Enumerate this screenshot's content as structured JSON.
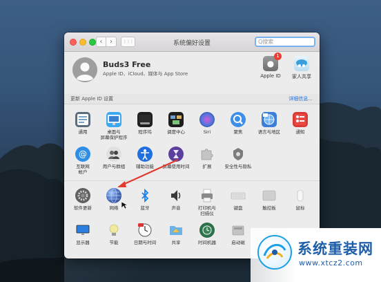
{
  "window": {
    "title": "系统偏好设置",
    "search_placeholder": "Q搜索",
    "nav": {
      "back": "‹",
      "forward": "›",
      "grid": "⋮⋮⋮"
    }
  },
  "account": {
    "name": "Buds3 Free",
    "subtitle": "Apple ID、iCloud、媒体与 App Store",
    "apple_id": {
      "label": "Apple ID",
      "badge": "1"
    },
    "family": {
      "label": "家人共享"
    }
  },
  "update_bar": {
    "left": "更新 Apple ID 设置",
    "right": "详细信息..."
  },
  "rows": [
    [
      {
        "id": "general",
        "label": "通用",
        "icon": "general-icon",
        "color": "#5c6c7d"
      },
      {
        "id": "desktop",
        "label": "桌面与\n屏幕保护程序",
        "icon": "desktop-icon",
        "color": "#3ca8f0"
      },
      {
        "id": "dock",
        "label": "程序坞",
        "icon": "dock-icon",
        "color": "#1e1e1e"
      },
      {
        "id": "mission",
        "label": "调度中心",
        "icon": "mission-control-icon",
        "color": "#1e1e1e"
      },
      {
        "id": "siri",
        "label": "Siri",
        "icon": "siri-icon",
        "color": "#2a1f4f"
      },
      {
        "id": "spotlight",
        "label": "聚焦",
        "icon": "spotlight-icon",
        "color": "#3f8fe8"
      },
      {
        "id": "language",
        "label": "语言与地区",
        "icon": "language-icon",
        "color": "#3d7fd8"
      },
      {
        "id": "notifications",
        "label": "通知",
        "icon": "notifications-icon",
        "color": "#d93b36"
      }
    ],
    [
      {
        "id": "internet",
        "label": "互联网\n帐户",
        "icon": "internet-accounts-icon",
        "color": "#2f8fe6"
      },
      {
        "id": "users",
        "label": "用户与群组",
        "icon": "users-groups-icon",
        "color": "#7d7d7d"
      },
      {
        "id": "accessibility",
        "label": "辅助功能",
        "icon": "accessibility-icon",
        "color": "#1f6fe0"
      },
      {
        "id": "screentime",
        "label": "屏幕使用时间",
        "icon": "screen-time-icon",
        "color": "#5a3f9c"
      },
      {
        "id": "extensions",
        "label": "扩展",
        "icon": "extensions-icon",
        "color": "#b9b9b9"
      },
      {
        "id": "security",
        "label": "安全性与隐私",
        "icon": "security-icon",
        "color": "#7c7c7c"
      }
    ],
    [
      {
        "id": "softwareupdate",
        "label": "软件更新",
        "icon": "software-update-icon",
        "color": "#6a6a6a"
      },
      {
        "id": "network",
        "label": "网络",
        "icon": "network-icon",
        "color": "#3a5d9e"
      },
      {
        "id": "bluetooth",
        "label": "蓝牙",
        "icon": "bluetooth-icon",
        "color": "#ffffff"
      },
      {
        "id": "sound",
        "label": "声音",
        "icon": "sound-icon",
        "color": "#ffffff"
      },
      {
        "id": "printers",
        "label": "打印机与\n扫描仪",
        "icon": "printers-icon",
        "color": "#cfcfcf"
      },
      {
        "id": "keyboard",
        "label": "键盘",
        "icon": "keyboard-icon",
        "color": "#d8d8d8"
      },
      {
        "id": "trackpad",
        "label": "触控板",
        "icon": "trackpad-icon",
        "color": "#c8c8c8"
      },
      {
        "id": "mouse",
        "label": "鼠标",
        "icon": "mouse-icon",
        "color": "#f2f2f2"
      }
    ],
    [
      {
        "id": "displays",
        "label": "显示器",
        "icon": "displays-icon",
        "color": "#2c7fe0"
      },
      {
        "id": "energy",
        "label": "节能",
        "icon": "energy-saver-icon",
        "color": "#e9e3a8"
      },
      {
        "id": "datetime",
        "label": "日期与时间",
        "icon": "date-time-icon",
        "color": "#f4f4f4"
      },
      {
        "id": "sharing",
        "label": "共享",
        "icon": "sharing-icon",
        "color": "#e7c45b"
      },
      {
        "id": "timemachine",
        "label": "时间机器",
        "icon": "time-machine-icon",
        "color": "#2f6b47"
      },
      {
        "id": "startup",
        "label": "启动磁",
        "icon": "startup-disk-icon",
        "color": "#bdbdbd"
      }
    ]
  ],
  "watermark": {
    "text": "系统重装网",
    "url": "www.xtcz2.com",
    "brand_color": "#1e5da8"
  }
}
